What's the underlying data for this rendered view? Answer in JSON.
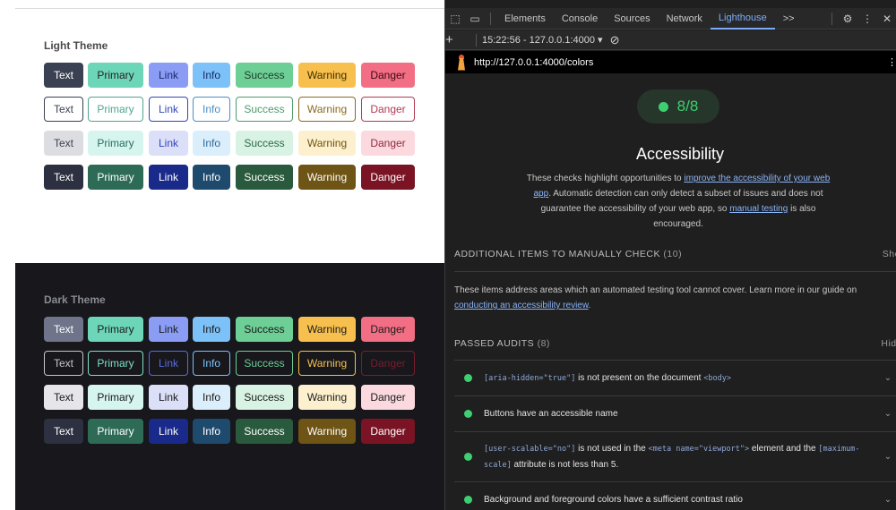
{
  "themes": {
    "light": {
      "title": "Light Theme",
      "rows": [
        [
          "Text",
          "Primary",
          "Link",
          "Info",
          "Success",
          "Warning",
          "Danger"
        ],
        [
          "Text",
          "Primary",
          "Link",
          "Info",
          "Success",
          "Warning",
          "Danger"
        ],
        [
          "Text",
          "Primary",
          "Link",
          "Info",
          "Success",
          "Warning",
          "Danger"
        ],
        [
          "Text",
          "Primary",
          "Link",
          "Info",
          "Success",
          "Warning",
          "Danger"
        ]
      ]
    },
    "dark": {
      "title": "Dark Theme",
      "rows": [
        [
          "Text",
          "Primary",
          "Link",
          "Info",
          "Success",
          "Warning",
          "Danger"
        ],
        [
          "Text",
          "Primary",
          "Link",
          "Info",
          "Success",
          "Warning",
          "Danger"
        ],
        [
          "Text",
          "Primary",
          "Link",
          "Info",
          "Success",
          "Warning",
          "Danger"
        ],
        [
          "Text",
          "Primary",
          "Link",
          "Info",
          "Success",
          "Warning",
          "Danger"
        ]
      ]
    }
  },
  "devtools": {
    "tabs": [
      "Elements",
      "Console",
      "Sources",
      "Network",
      "Lighthouse"
    ],
    "active_tab": "Lighthouse",
    "more_tabs": ">>",
    "report_selector": "15:22:56 - 127.0.0.1:4000 ▾",
    "url": "http://127.0.0.1:4000/colors",
    "score": "8/8",
    "category_title": "Accessibility",
    "desc": {
      "p1": "These checks highlight opportunities to ",
      "link1": "improve the accessibility of your web app",
      "p2": ". Automatic detection can only detect a subset of issues and does not guarantee the accessibility of your web app, so ",
      "link2": "manual testing",
      "p3": " is also encouraged."
    },
    "manual_header": "ADDITIONAL ITEMS TO MANUALLY CHECK",
    "manual_count": "(10)",
    "manual_toggle": "Show",
    "manual_text": "These items address areas which an automated testing tool cannot cover. Learn more in our guide on ",
    "manual_link": "conducting an accessibility review",
    "manual_end": ".",
    "passed_header": "PASSED AUDITS",
    "passed_count": "(8)",
    "passed_toggle": "Hide",
    "audits": {
      "a1_code": "[aria-hidden=\"true\"]",
      "a1_text": " is not present on the document ",
      "a1_code2": "<body>",
      "a2_text": "Buttons have an accessible name",
      "a3_code": "[user-scalable=\"no\"]",
      "a3_text": " is not used in the ",
      "a3_code2": "<meta name=\"viewport\">",
      "a3_text2": " element and the ",
      "a3_code3": "[maximum-scale]",
      "a3_text3": " attribute is not less than 5.",
      "a4_text": "Background and foreground colors have a sufficient contrast ratio"
    }
  },
  "colors": {
    "light_solid": [
      "#3a4152",
      "#6dd6b8",
      "#8b9cf5",
      "#7cc1f7",
      "#6dcf95",
      "#f7c04e",
      "#f26e84"
    ],
    "light_solid_fg": [
      "#ffffff",
      "#222222",
      "#1b2a6b",
      "#1b2a6b",
      "#1f3b2a",
      "#3d2d00",
      "#3b0a12"
    ],
    "light_outline": [
      "#3a4152",
      "#4fa590",
      "#3346b8",
      "#4a8ec8",
      "#4d9a6a",
      "#8a6a1e",
      "#b23a50"
    ],
    "light_pale_bg": [
      "#dcdde0",
      "#d6f5ee",
      "#dcdff8",
      "#dbeefb",
      "#d8f2e3",
      "#fdf0cf",
      "#fbd9df"
    ],
    "light_pale_fg": [
      "#3a4152",
      "#2a6e5e",
      "#3346b8",
      "#2f6a98",
      "#2d6a45",
      "#6e5310",
      "#8f2a3c"
    ],
    "light_dark_bg": [
      "#2c3040",
      "#2e6b57",
      "#1a2a8a",
      "#1e4a6e",
      "#2a5a3d",
      "#6e5415",
      "#7a1424"
    ],
    "dark_solid": [
      "#6f748a",
      "#6dd6b8",
      "#8b9cf5",
      "#7cc1f7",
      "#6dcf95",
      "#f7c04e",
      "#f26e84"
    ],
    "dark_solid_fg": [
      "#ffffff",
      "#1a1a1a",
      "#1a1a1a",
      "#1a1a1a",
      "#1a1a1a",
      "#1a1a1a",
      "#1a1a1a"
    ],
    "dark_outline_fg": [
      "#c6c6cc",
      "#7fe0c4",
      "#5a6ae0",
      "#7cc1f7",
      "#6dcf95",
      "#f7c04e",
      "#7a1d2e"
    ],
    "dark_pale_bg": [
      "#e6e6ea",
      "#d6f5ee",
      "#dcdff8",
      "#dbeefb",
      "#d8f2e3",
      "#fdf0cf",
      "#fbd9df"
    ],
    "dark_dark_bg": [
      "#2c3040",
      "#2e6b57",
      "#1a2a8a",
      "#1e4a6e",
      "#2a5a3d",
      "#6e5415",
      "#7a1424"
    ]
  }
}
